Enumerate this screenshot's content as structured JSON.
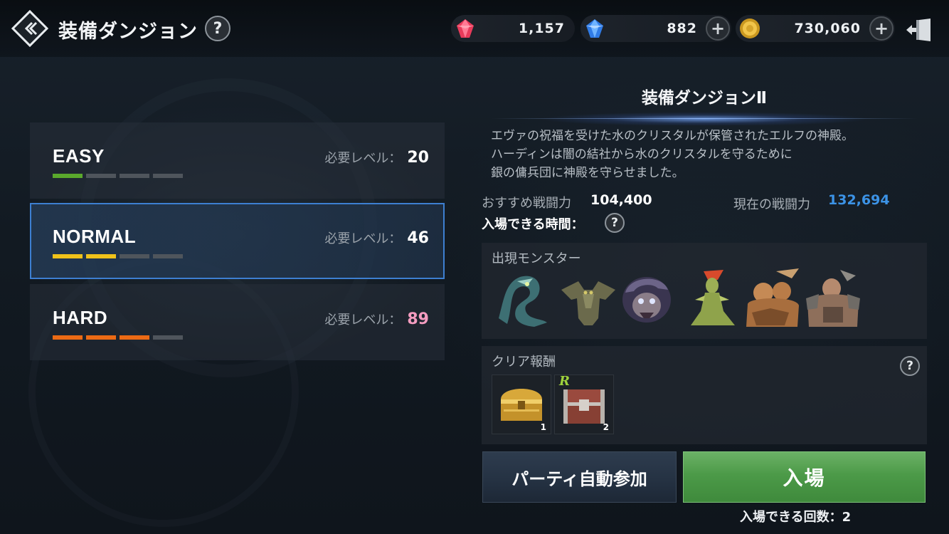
{
  "header": {
    "title": "装備ダンジョン",
    "help_label": "?",
    "currencies": [
      {
        "name": "red-gem",
        "amount": "1,157"
      },
      {
        "name": "blue-gem",
        "amount": "882",
        "plus": "+"
      },
      {
        "name": "gold",
        "amount": "730,060",
        "plus": "+"
      }
    ]
  },
  "difficulties": [
    {
      "name": "EASY",
      "req_label": "必要レベル：",
      "req_value": "20",
      "filled_bars": 1,
      "total_bars": 4,
      "bar_color": "#5aa82c",
      "value_color": "#ffffff"
    },
    {
      "name": "NORMAL",
      "req_label": "必要レベル：",
      "req_value": "46",
      "filled_bars": 2,
      "total_bars": 4,
      "bar_color": "#f0c21a",
      "value_color": "#ffffff",
      "selected": true
    },
    {
      "name": "HARD",
      "req_label": "必要レベル：",
      "req_value": "89",
      "filled_bars": 3,
      "total_bars": 4,
      "bar_color": "#ec6a14",
      "value_color": "#f49cc0"
    }
  ],
  "dungeon": {
    "title": "装備ダンジョンⅡ",
    "description": [
      "エヴァの祝福を受けた水のクリスタルが保管されたエルフの神殿。",
      "ハーディンは闇の結社から水のクリスタルを守るために",
      "銀の傭兵団に神殿を守らせました。"
    ],
    "recommended_power_label": "おすすめ戦闘力",
    "recommended_power_value": "104,400",
    "current_power_label": "現在の戦闘力",
    "current_power_value": "132,694",
    "entry_time_label": "入場できる時間：",
    "help_label": "?"
  },
  "monsters": {
    "title": "出現モンスター",
    "items": [
      {
        "icon": "serpent-monster-icon"
      },
      {
        "icon": "gargoyle-monster-icon"
      },
      {
        "icon": "helmeted-orc-monster-icon"
      },
      {
        "icon": "naga-monster-icon"
      },
      {
        "icon": "two-headed-ogre-monster-icon"
      },
      {
        "icon": "armored-brute-monster-icon"
      }
    ]
  },
  "rewards": {
    "title": "クリア報酬",
    "help_label": "?",
    "items": [
      {
        "icon": "gold-chest-icon",
        "count": "1"
      },
      {
        "icon": "red-chest-icon",
        "count": "2",
        "grade": "R"
      }
    ]
  },
  "actions": {
    "party_label": "パーティ自動参加",
    "enter_label": "入場",
    "entry_count": "入場できる回数：2"
  },
  "colors": {
    "accent_blue": "#3c93e6",
    "selected_border": "#3d7fd1",
    "enter_green": "#4c9a48"
  }
}
